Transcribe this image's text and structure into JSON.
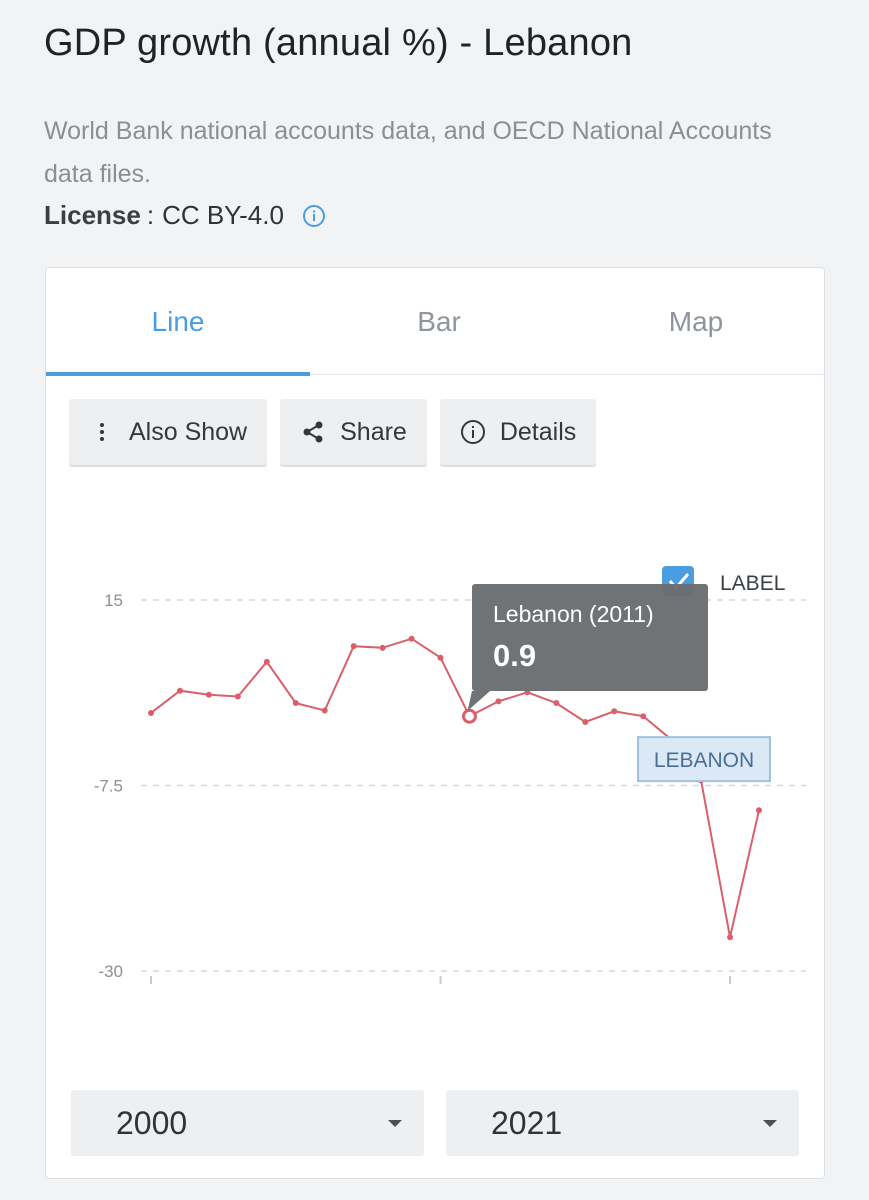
{
  "header": {
    "title": "GDP growth (annual %) - Lebanon",
    "source": "World Bank national accounts data, and OECD National Accounts data files.",
    "license_label": "License",
    "license_value": "CC BY-4.0"
  },
  "tabs": [
    {
      "label": "Line",
      "active": true
    },
    {
      "label": "Bar",
      "active": false
    },
    {
      "label": "Map",
      "active": false
    }
  ],
  "toolbar": {
    "also_show": "Also Show",
    "share": "Share",
    "details": "Details"
  },
  "legend": {
    "label_toggle": "LABEL",
    "label_checked": true
  },
  "tooltip": {
    "title": "Lebanon (2011)",
    "value": "0.9"
  },
  "series_label": "LEBANON",
  "range": {
    "from": "2000",
    "to": "2021"
  },
  "colors": {
    "accent": "#4a9ee0",
    "series": "#d9606a",
    "tooltip_bg": "#6a6d70",
    "label_box_bg": "#dbe8f5"
  },
  "chart_data": {
    "type": "line",
    "x": [
      2000,
      2001,
      2002,
      2003,
      2004,
      2005,
      2006,
      2007,
      2008,
      2009,
      2010,
      2011,
      2012,
      2013,
      2014,
      2015,
      2016,
      2017,
      2018,
      2019,
      2020,
      2021
    ],
    "series": [
      {
        "values": [
          1.3,
          4.0,
          3.5,
          3.3,
          7.5,
          2.5,
          1.6,
          9.4,
          9.2,
          10.3,
          8.0,
          0.9,
          2.7,
          3.8,
          2.5,
          0.2,
          1.5,
          0.9,
          -2.0,
          -6.9,
          -25.9,
          -10.5
        ]
      }
    ],
    "ylim": [
      -30,
      15
    ],
    "yticks": [
      "15",
      "-7.5",
      "-30"
    ],
    "xticks_at": [
      2000,
      2010,
      2020
    ],
    "grid": true,
    "highlight_year": 2011
  }
}
